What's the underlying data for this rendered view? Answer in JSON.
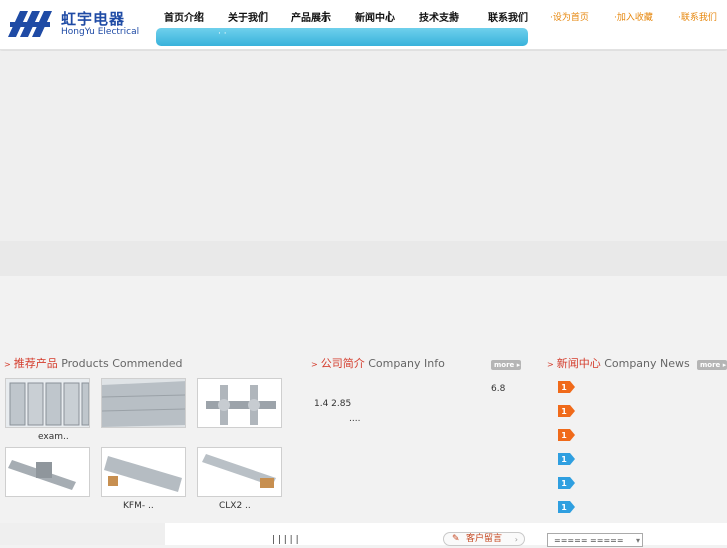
{
  "header": {
    "logo_cn": "虹宇电器",
    "logo_en": "HongYu Electrical",
    "nav": [
      "首页介绍",
      "关于我们",
      "产品展示",
      "新闻中心",
      "技术支持",
      "联系我们"
    ],
    "quick_links": [
      "·设为首页",
      "·加入收藏",
      "·联系我们"
    ],
    "search_dots": "· ·"
  },
  "sections": {
    "products": {
      "cn": "推荐产品",
      "en": "Products Commended"
    },
    "info": {
      "cn": "公司简介",
      "en": "Company Info"
    },
    "news": {
      "cn": "新闻中心",
      "en": "Company News"
    },
    "more_label": "more"
  },
  "products": {
    "captions": [
      "exam..",
      "",
      "",
      "",
      "KFM-    ..",
      "CLX2     .."
    ]
  },
  "company_info": {
    "line1": "6.8",
    "line2": "1.4   2.85",
    "line3": "...."
  },
  "news": {
    "badge_colors": [
      "#f06a1a",
      "#f06a1a",
      "#f06a1a",
      "#2f9fe0",
      "#2f9fe0",
      "#2f9fe0"
    ],
    "badge_number": "1"
  },
  "footer": {
    "links": "|    |    |    |    |",
    "message_button": "客户留言",
    "select_value": "=====   ====="
  }
}
